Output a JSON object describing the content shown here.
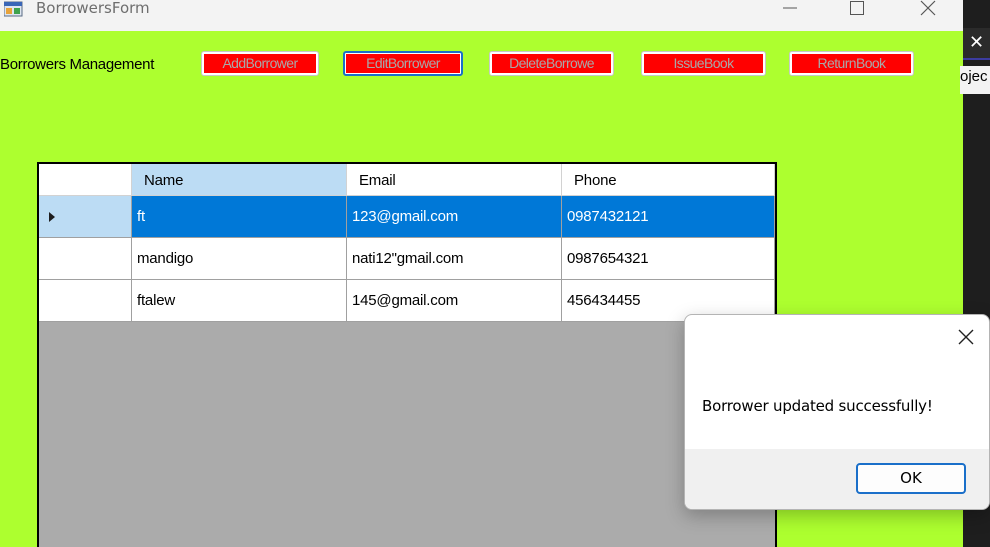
{
  "window": {
    "title": "BorrowersForm",
    "form_label": "Borrowers Management",
    "background_color": "#adff2f"
  },
  "toolbar": {
    "buttons": [
      {
        "label": "AddBorrower"
      },
      {
        "label": "EditBorrower"
      },
      {
        "label": "DeleteBorrowe"
      },
      {
        "label": "IssueBook"
      },
      {
        "label": "ReturnBook"
      }
    ]
  },
  "grid": {
    "columns": [
      "Name",
      "Email",
      "Phone"
    ],
    "rows": [
      {
        "name": "ft",
        "email": "123@gmail.com",
        "phone": "0987432121",
        "selected": true
      },
      {
        "name": "mandigo",
        "email": "nati12\"gmail.com",
        "phone": "0987654321"
      },
      {
        "name": "ftalew",
        "email": "145@gmail.com",
        "phone": "456434455"
      }
    ],
    "selection_color": "#0078d7"
  },
  "background_app": {
    "close_glyph": "✕",
    "partial_text": "ojec"
  },
  "message_box": {
    "text": "Borrower updated successfully!",
    "ok_label": "OK",
    "close_glyph": "✕"
  }
}
